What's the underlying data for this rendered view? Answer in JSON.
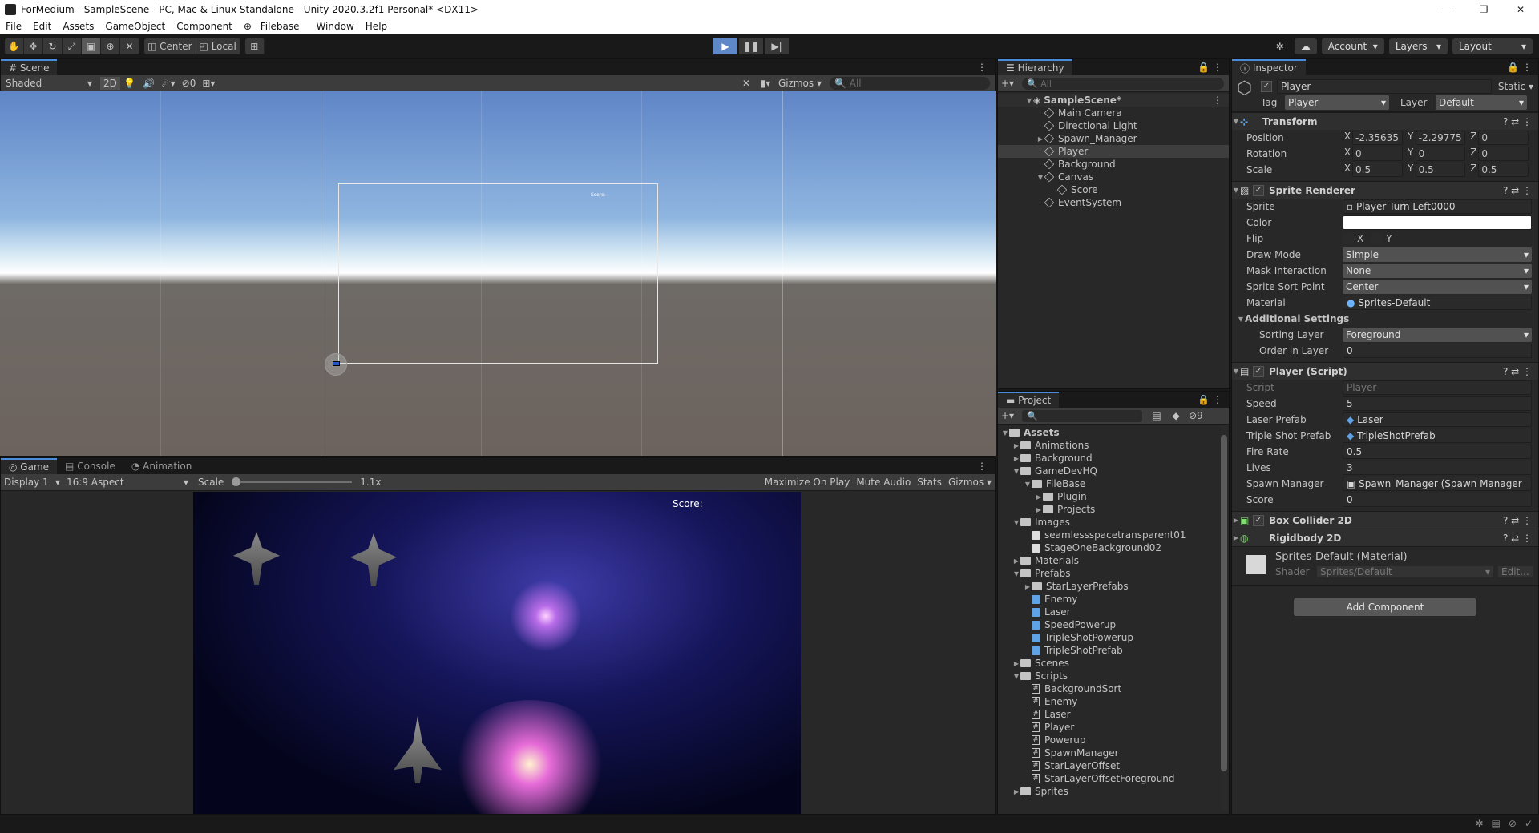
{
  "window": {
    "title": "ForMedium - SampleScene - PC, Mac & Linux Standalone - Unity 2020.3.2f1 Personal* <DX11>",
    "minimize": "—",
    "maximize": "❐",
    "close": "✕"
  },
  "menu": [
    "File",
    "Edit",
    "Assets",
    "GameObject",
    "Component",
    "Filebase",
    "Window",
    "Help"
  ],
  "toolbar": {
    "center": "Center",
    "local": "Local",
    "account": "Account",
    "layers": "Layers",
    "layout": "Layout"
  },
  "scene": {
    "tab": "Scene",
    "shading": "Shaded",
    "mode2d": "2D",
    "hidden_count": "0",
    "gizmos": "Gizmos",
    "search_placeholder": "All",
    "canvas_text": "Score:"
  },
  "game": {
    "tabs": [
      "Game",
      "Console",
      "Animation"
    ],
    "display": "Display 1",
    "aspect": "16:9 Aspect",
    "scale_label": "Scale",
    "scale_value": "1.1x",
    "maximize": "Maximize On Play",
    "mute": "Mute Audio",
    "stats": "Stats",
    "gizmos": "Gizmos",
    "score_text": "Score:"
  },
  "hierarchy": {
    "tab": "Hierarchy",
    "search_placeholder": "All",
    "scene": "SampleScene*",
    "items": [
      "Main Camera",
      "Directional Light",
      "Spawn_Manager",
      "Player",
      "Background",
      "Canvas",
      "Score",
      "EventSystem"
    ]
  },
  "project": {
    "tab": "Project",
    "badge": "9",
    "root": "Assets",
    "tree": [
      {
        "name": "Animations",
        "depth": 1,
        "kind": "folder",
        "open": false
      },
      {
        "name": "Background",
        "depth": 1,
        "kind": "folder",
        "open": false
      },
      {
        "name": "GameDevHQ",
        "depth": 1,
        "kind": "folder",
        "open": true
      },
      {
        "name": "FileBase",
        "depth": 2,
        "kind": "folder",
        "open": true
      },
      {
        "name": "Plugin",
        "depth": 3,
        "kind": "folder",
        "open": false
      },
      {
        "name": "Projects",
        "depth": 3,
        "kind": "folder",
        "open": false
      },
      {
        "name": "Images",
        "depth": 1,
        "kind": "folder",
        "open": true
      },
      {
        "name": "seamlessspacetransparent01",
        "depth": 2,
        "kind": "image"
      },
      {
        "name": "StageOneBackground02",
        "depth": 2,
        "kind": "image"
      },
      {
        "name": "Materials",
        "depth": 1,
        "kind": "folder",
        "open": false
      },
      {
        "name": "Prefabs",
        "depth": 1,
        "kind": "folder",
        "open": true
      },
      {
        "name": "StarLayerPrefabs",
        "depth": 2,
        "kind": "folder",
        "open": false
      },
      {
        "name": "Enemy",
        "depth": 2,
        "kind": "prefab"
      },
      {
        "name": "Laser",
        "depth": 2,
        "kind": "prefab"
      },
      {
        "name": "SpeedPowerup",
        "depth": 2,
        "kind": "prefab"
      },
      {
        "name": "TripleShotPowerup",
        "depth": 2,
        "kind": "prefab"
      },
      {
        "name": "TripleShotPrefab",
        "depth": 2,
        "kind": "prefab"
      },
      {
        "name": "Scenes",
        "depth": 1,
        "kind": "folder",
        "open": false
      },
      {
        "name": "Scripts",
        "depth": 1,
        "kind": "folder",
        "open": true
      },
      {
        "name": "BackgroundSort",
        "depth": 2,
        "kind": "script"
      },
      {
        "name": "Enemy",
        "depth": 2,
        "kind": "script"
      },
      {
        "name": "Laser",
        "depth": 2,
        "kind": "script"
      },
      {
        "name": "Player",
        "depth": 2,
        "kind": "script"
      },
      {
        "name": "Powerup",
        "depth": 2,
        "kind": "script"
      },
      {
        "name": "SpawnManager",
        "depth": 2,
        "kind": "script"
      },
      {
        "name": "StarLayerOffset",
        "depth": 2,
        "kind": "script"
      },
      {
        "name": "StarLayerOffsetForeground",
        "depth": 2,
        "kind": "script"
      },
      {
        "name": "Sprites",
        "depth": 1,
        "kind": "folder",
        "open": false
      }
    ]
  },
  "inspector": {
    "tab": "Inspector",
    "object_name": "Player",
    "static_label": "Static",
    "tag_label": "Tag",
    "tag_value": "Player",
    "layer_label": "Layer",
    "layer_value": "Default",
    "transform": {
      "title": "Transform",
      "position_label": "Position",
      "rotation_label": "Rotation",
      "scale_label": "Scale",
      "pos": [
        "-2.35635",
        "-2.29775",
        "0"
      ],
      "rot": [
        "0",
        "0",
        "0"
      ],
      "scl": [
        "0.5",
        "0.5",
        "0.5"
      ]
    },
    "sprite_renderer": {
      "title": "Sprite Renderer",
      "sprite_label": "Sprite",
      "sprite": "Player Turn Left0000",
      "color_label": "Color",
      "flip_label": "Flip",
      "flip_x": "X",
      "flip_y": "Y",
      "draw_mode_label": "Draw Mode",
      "draw_mode": "Simple",
      "mask_label": "Mask Interaction",
      "mask": "None",
      "sort_point_label": "Sprite Sort Point",
      "sort_point": "Center",
      "material_label": "Material",
      "material": "Sprites-Default",
      "additional": "Additional Settings",
      "sorting_layer_label": "Sorting Layer",
      "sorting_layer": "Foreground",
      "order_label": "Order in Layer",
      "order": "0"
    },
    "player_script": {
      "title": "Player (Script)",
      "script_label": "Script",
      "script": "Player",
      "speed_label": "Speed",
      "speed": "5",
      "laser_label": "Laser Prefab",
      "laser": "Laser",
      "triple_label": "Triple Shot Prefab",
      "triple": "TripleShotPrefab",
      "fire_label": "Fire Rate",
      "fire": "0.5",
      "lives_label": "Lives",
      "lives": "3",
      "spawn_label": "Spawn Manager",
      "spawn": "Spawn_Manager (Spawn Manager",
      "score_label": "Score",
      "score": "0"
    },
    "box_collider": "Box Collider 2D",
    "rigidbody": "Rigidbody 2D",
    "material_name": "Sprites-Default (Material)",
    "shader_label": "Shader",
    "shader": "Sprites/Default",
    "edit": "Edit...",
    "add_component": "Add Component"
  },
  "colors": {
    "accent": "#4b8bdc",
    "play": "#5e88c7",
    "panel": "#282828"
  }
}
